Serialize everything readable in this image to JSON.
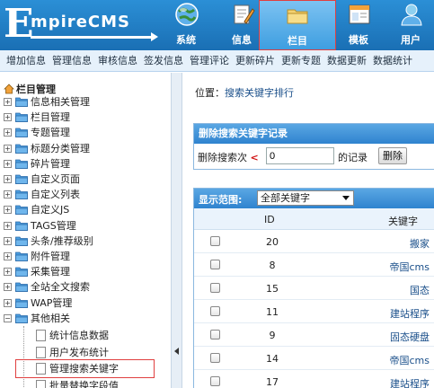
{
  "app": {
    "logo_initial": "E",
    "logo_rest": "mpireCMS"
  },
  "nav": [
    {
      "label": "系统",
      "icon": "globe-icon"
    },
    {
      "label": "信息",
      "icon": "document-edit-icon"
    },
    {
      "label": "栏目",
      "icon": "folder-icon",
      "active": true
    },
    {
      "label": "模板",
      "icon": "window-icon"
    },
    {
      "label": "用户",
      "icon": "user-icon"
    }
  ],
  "subbar": [
    "增加信息",
    "管理信息",
    "审核信息",
    "签发信息",
    "管理评论",
    "更新碎片",
    "更新专题",
    "数据更新",
    "数据统计"
  ],
  "tree": {
    "title": "栏目管理",
    "items": [
      "信息相关管理",
      "栏目管理",
      "专题管理",
      "标题分类管理",
      "碎片管理",
      "自定义页面",
      "自定义列表",
      "自定义JS",
      "TAGS管理",
      "头条/推荐级别",
      "附件管理",
      "采集管理",
      "全站全文搜索",
      "WAP管理",
      "其他相关"
    ],
    "children": [
      "统计信息数据",
      "用户发布统计",
      "管理搜索关键字",
      "批量替换字段值"
    ]
  },
  "location": {
    "prefix": "位置：",
    "link": "搜索关键字排行"
  },
  "delete_panel": {
    "title": "删除搜索关键字记录",
    "label": "删除搜索次",
    "lt": "<",
    "value": "0",
    "suffix": "的记录",
    "button": "删除"
  },
  "list_panel": {
    "scope_label": "显示范围:",
    "scope_value": "全部关键字",
    "col_id": "ID",
    "col_keyword": "关键字",
    "rows": [
      {
        "id": "20",
        "keyword": "搬家"
      },
      {
        "id": "8",
        "keyword": "帝国cms"
      },
      {
        "id": "15",
        "keyword": "国态"
      },
      {
        "id": "11",
        "keyword": "建站程序"
      },
      {
        "id": "9",
        "keyword": "固态硬盘"
      },
      {
        "id": "14",
        "keyword": "帝国cms"
      },
      {
        "id": "17",
        "keyword": "建站程序"
      }
    ]
  },
  "colors": {
    "header": "#1f7ec4",
    "highlight": "#e04040",
    "panel_head": "#3a8fd8",
    "folder": "#f0c94a"
  }
}
